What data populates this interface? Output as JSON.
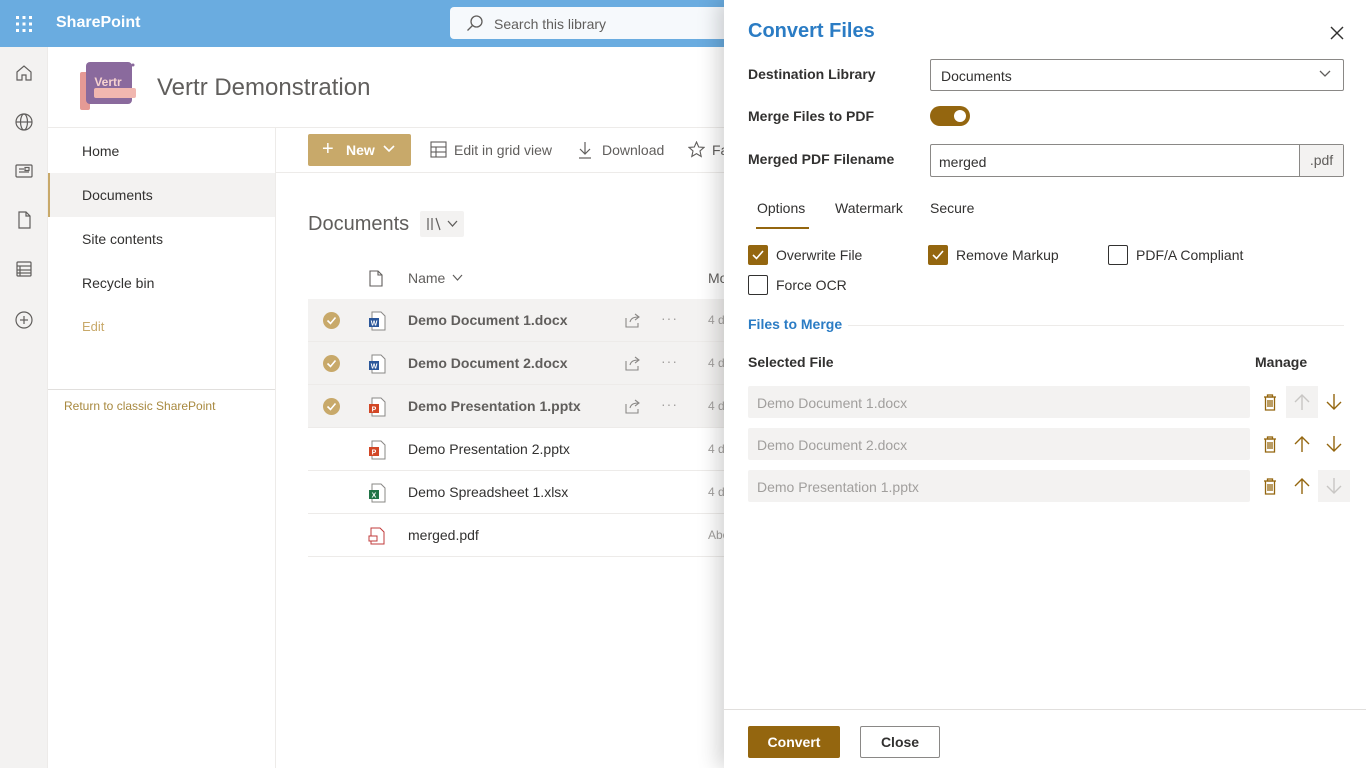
{
  "suitebar": {
    "brand": "SharePoint",
    "search_placeholder": "Search this library"
  },
  "site": {
    "logo_text": "Vertr",
    "title": "Vertr Demonstration"
  },
  "nav": {
    "items": [
      "Home",
      "Documents",
      "Site contents",
      "Recycle bin"
    ],
    "edit": "Edit",
    "classic": "Return to classic SharePoint"
  },
  "commands": {
    "new": "New",
    "grid": "Edit in grid view",
    "download": "Download",
    "fav": "Fa"
  },
  "library": {
    "title": "Documents",
    "col_name": "Name",
    "col_modified": "Mo",
    "files": [
      {
        "name": "Demo Document 1.docx",
        "type": "word",
        "modified": "4 d",
        "selected": true
      },
      {
        "name": "Demo Document 2.docx",
        "type": "word",
        "modified": "4 d",
        "selected": true
      },
      {
        "name": "Demo Presentation 1.pptx",
        "type": "ppt",
        "modified": "4 d",
        "selected": true
      },
      {
        "name": "Demo Presentation 2.pptx",
        "type": "ppt",
        "modified": "4 d",
        "selected": false
      },
      {
        "name": "Demo Spreadsheet 1.xlsx",
        "type": "excel",
        "modified": "4 d",
        "selected": false
      },
      {
        "name": "merged.pdf",
        "type": "pdf",
        "modified": "Abo",
        "selected": false
      }
    ]
  },
  "panel": {
    "title": "Convert Files",
    "dest_label": "Destination Library",
    "dest_value": "Documents",
    "merge_label": "Merge Files to PDF",
    "merge_on": true,
    "filename_label": "Merged PDF Filename",
    "filename_value": "merged",
    "filename_suffix": ".pdf",
    "tabs": [
      "Options",
      "Watermark",
      "Secure"
    ],
    "options": {
      "overwrite": "Overwrite File",
      "remove_markup": "Remove Markup",
      "pdfa": "PDF/A Compliant",
      "ocr": "Force OCR"
    },
    "files_title": "Files to Merge",
    "col_selected": "Selected File",
    "col_manage": "Manage",
    "merge_files": [
      "Demo Document 1.docx",
      "Demo Document 2.docx",
      "Demo Presentation 1.pptx"
    ],
    "convert": "Convert",
    "close": "Close"
  },
  "colors": {
    "suitebar": "#6aace0",
    "accent": "#c8a96a",
    "primary": "#94660f",
    "title_blue": "#2b7cc4"
  }
}
